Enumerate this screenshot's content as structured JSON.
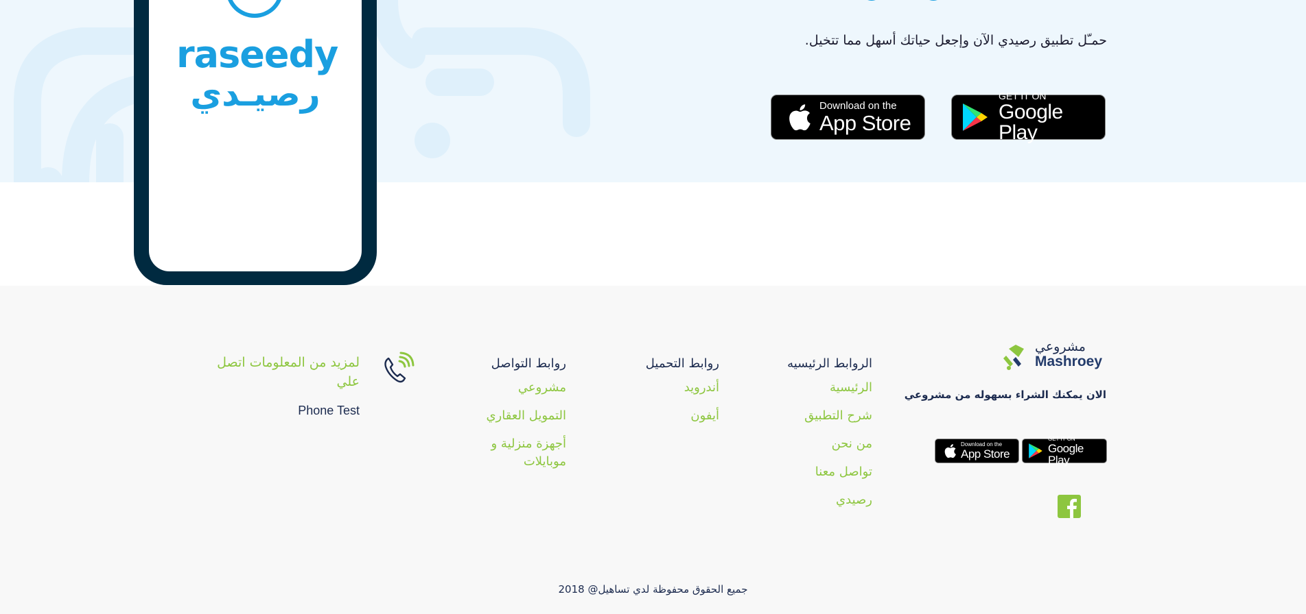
{
  "promo": {
    "text": "حمـّل تطبيق رصيدي الآن وإجعل حياتك أسهل مما تتخيل.",
    "app_store": {
      "small": "Download on the",
      "big": "App Store"
    },
    "google_play": {
      "small": "GET IT ON",
      "big": "Google Play"
    }
  },
  "phone": {
    "brand_en": "raseedy",
    "brand_ar": "رصيـدي",
    "brand_color": "#1a9fe0",
    "frame_color": "#002a40"
  },
  "footer": {
    "logo_ar": "مشروعي",
    "logo_en": "Mashroey",
    "tagline": "الان يمكنك الشراء بسهوله من مشروعي",
    "app_store": {
      "small": "Download on the",
      "big": "App Store"
    },
    "google_play": {
      "small": "GET IT ON",
      "big": "Google Play"
    },
    "facebook_icon": "facebook-icon",
    "main_links": {
      "title": "الروابط الرئيسيه",
      "items": [
        "الرئيسية",
        "شرح التطبيق",
        "من نحن",
        "تواصل معنا",
        "رصيدي"
      ]
    },
    "download_links": {
      "title": "روابط التحميل",
      "items": [
        "أندرويد",
        "أيفون"
      ]
    },
    "social_links": {
      "title": "روابط التواصل",
      "items": [
        "مشروعي",
        "التمويل العقاري",
        "أجهزة منزلية و موبايلات"
      ]
    },
    "contact": {
      "icon": "phone-icon",
      "title": "لمزيد من المعلومات اتصل علي",
      "phone": "Phone Test"
    },
    "copyright": "جميع الحقوق محفوظة لدي تساهيل@ 2018",
    "accent_color": "#8dc63f",
    "text_color": "#1c2b4f"
  }
}
